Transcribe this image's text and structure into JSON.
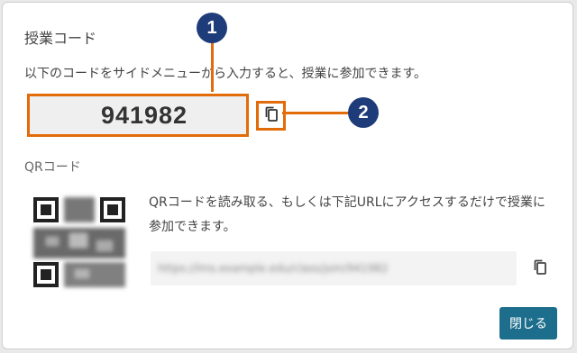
{
  "dialog": {
    "title": "授業コード",
    "description": "以下のコードをサイドメニューから入力すると、授業に参加できます。",
    "code": "941982",
    "callouts": {
      "first": "1",
      "second": "2"
    },
    "qr_label": "QRコード",
    "qr_text": "QRコードを読み取る、もしくは下記URLにアクセスするだけで授業に参加できます。",
    "url": "https://lms.example.edu/class/join/941982",
    "close_label": "閉じる"
  },
  "colors": {
    "highlight": "#e26b0a",
    "badge": "#1f3c7a",
    "primary_button": "#1d6e8d"
  },
  "icons": {
    "code_copy": "copy-icon",
    "url_copy": "copy-icon"
  }
}
